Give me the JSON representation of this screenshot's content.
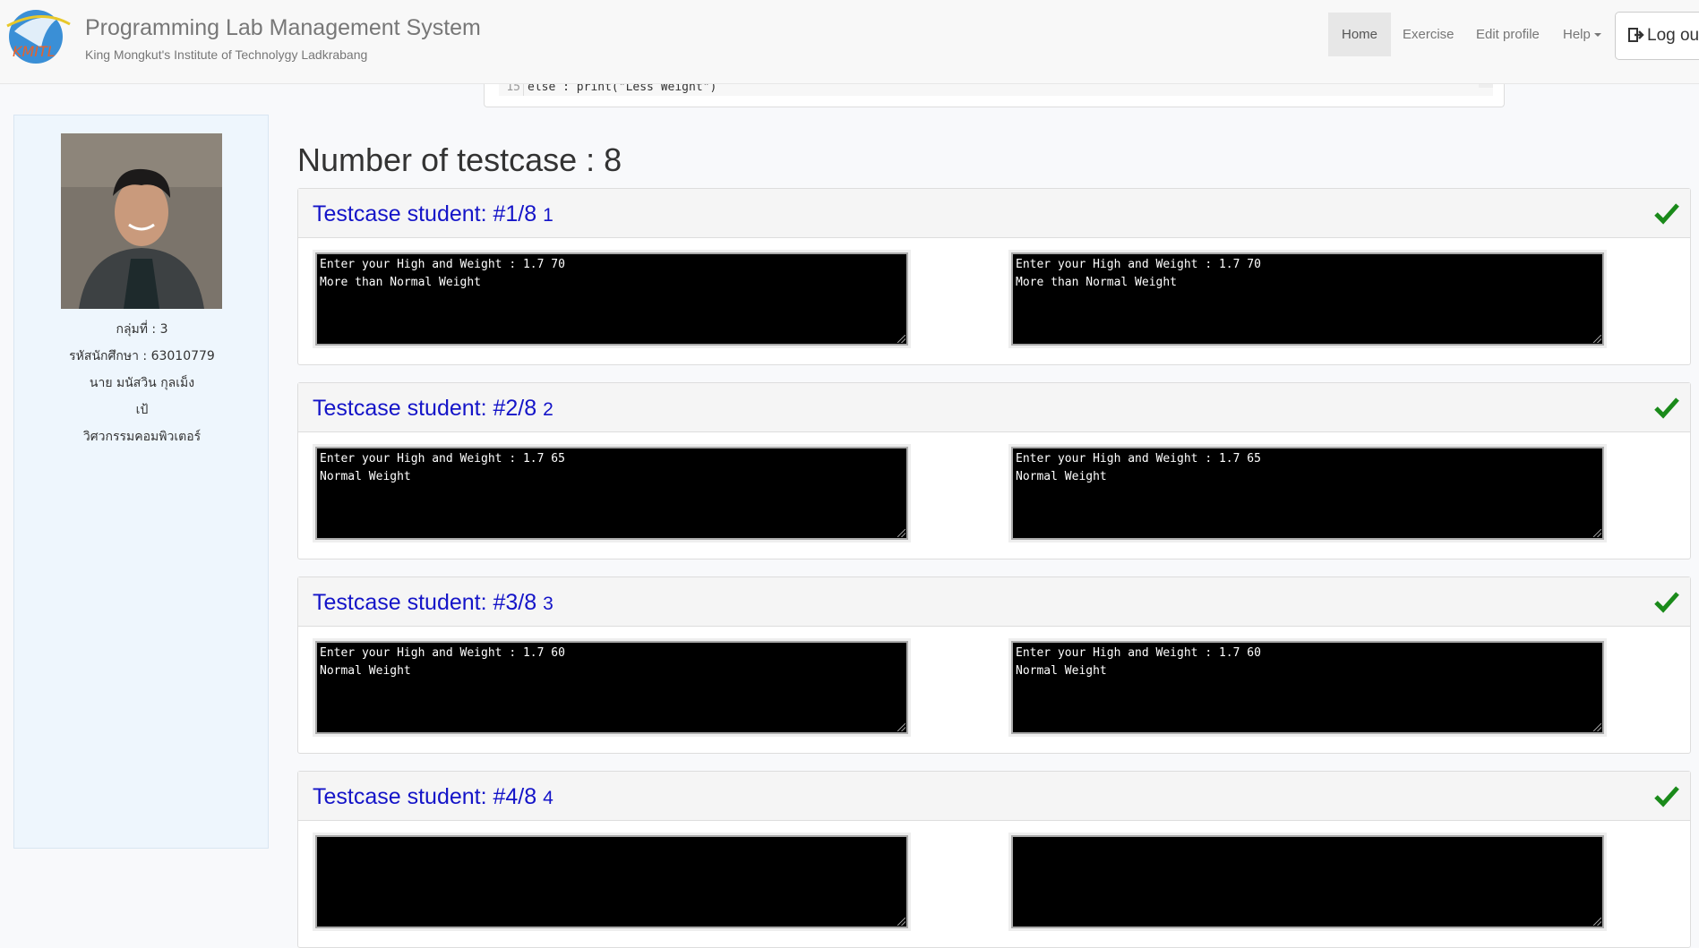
{
  "navbar": {
    "title": "Programming Lab Management System",
    "subtitle": "King Mongkut's Institute of Technolygy Ladkrabang",
    "logo_text": "KMITL",
    "items": [
      {
        "label": "Home",
        "active": true
      },
      {
        "label": "Exercise"
      },
      {
        "label": "Edit profile"
      },
      {
        "label": "Help"
      }
    ],
    "logout_label": "Log out"
  },
  "code": {
    "line_number": "15",
    "line_text": "else : print(\"Less Weight\")"
  },
  "profile": {
    "group": "กลุ่มที่ : 3",
    "student_id": "รหัสนักศึกษา : 63010779",
    "name": "นาย มนัสวิน กุลเม็ง",
    "nickname": "เป้",
    "department": "วิศวกรรมคอมพิวเตอร์"
  },
  "main": {
    "heading": "Number of testcase : 8",
    "testcases": [
      {
        "title": "Testcase student: #1/8",
        "num": "1",
        "status": "pass",
        "student_output": "Enter your High and Weight : 1.7 70\nMore than Normal Weight",
        "expected_output": "Enter your High and Weight : 1.7 70\nMore than Normal Weight"
      },
      {
        "title": "Testcase student: #2/8",
        "num": "2",
        "status": "pass",
        "student_output": "Enter your High and Weight : 1.7 65\nNormal Weight",
        "expected_output": "Enter your High and Weight : 1.7 65\nNormal Weight"
      },
      {
        "title": "Testcase student: #3/8",
        "num": "3",
        "status": "pass",
        "student_output": "Enter your High and Weight : 1.7 60\nNormal Weight",
        "expected_output": "Enter your High and Weight : 1.7 60\nNormal Weight"
      },
      {
        "title": "Testcase student: #4/8",
        "num": "4",
        "status": "pass",
        "student_output": "",
        "expected_output": ""
      }
    ]
  },
  "colors": {
    "title_blue": "#1414c8",
    "check_green": "#1a8a1a"
  }
}
